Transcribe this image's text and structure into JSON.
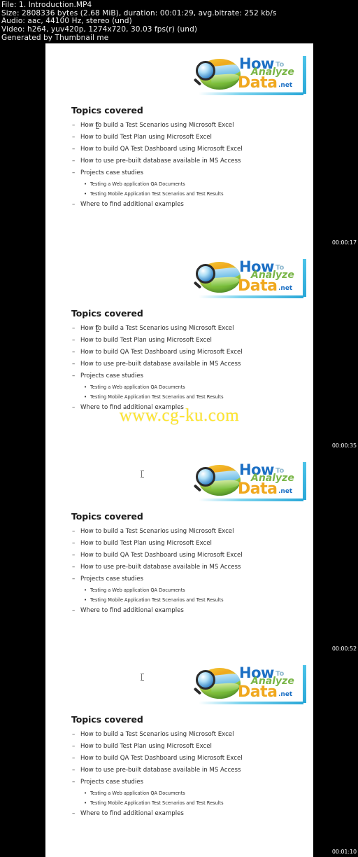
{
  "fileinfo": {
    "line1": "File: 1. Introduction.MP4",
    "line2": "Size: 2808336 bytes (2.68 MiB), duration: 00:01:29, avg.bitrate: 252 kb/s",
    "line3": "Audio: aac, 44100 Hz, stereo (und)",
    "line4": "Video: h264, yuv420p, 1274x720, 30.03 fps(r) (und)",
    "line5": "Generated by Thumbnail me"
  },
  "logo": {
    "word_how": "How",
    "word_to": "To",
    "word_analyze": "Analyze",
    "word_data": "Data",
    "word_net": ".net",
    "colors": {
      "how": "#1b6fc4",
      "to": "#8fb9cf",
      "analyze": "#7ab648",
      "data": "#f0a81e",
      "net": "#1b6fc4",
      "bar": "#2aa8d8"
    }
  },
  "slide": {
    "title": "Topics covered",
    "bullets": [
      "How to build a Test Scenarios using Microsoft Excel",
      "How to build Test Plan using Microsoft Excel",
      "How to build QA Test Dashboard using Microsoft Excel",
      "How to use pre-built database available in MS Access",
      "Projects case studies",
      "Where to find additional examples"
    ],
    "sub_bullets": [
      "Testing a Web application QA Documents",
      "Testing Mobile Application Test Scenarios and Test Results"
    ]
  },
  "watermark": {
    "text": "www.cg-ku.com",
    "color": "#ffe62e"
  },
  "timestamps": [
    "00:00:17",
    "00:00:35",
    "00:00:52",
    "00:01:10"
  ]
}
